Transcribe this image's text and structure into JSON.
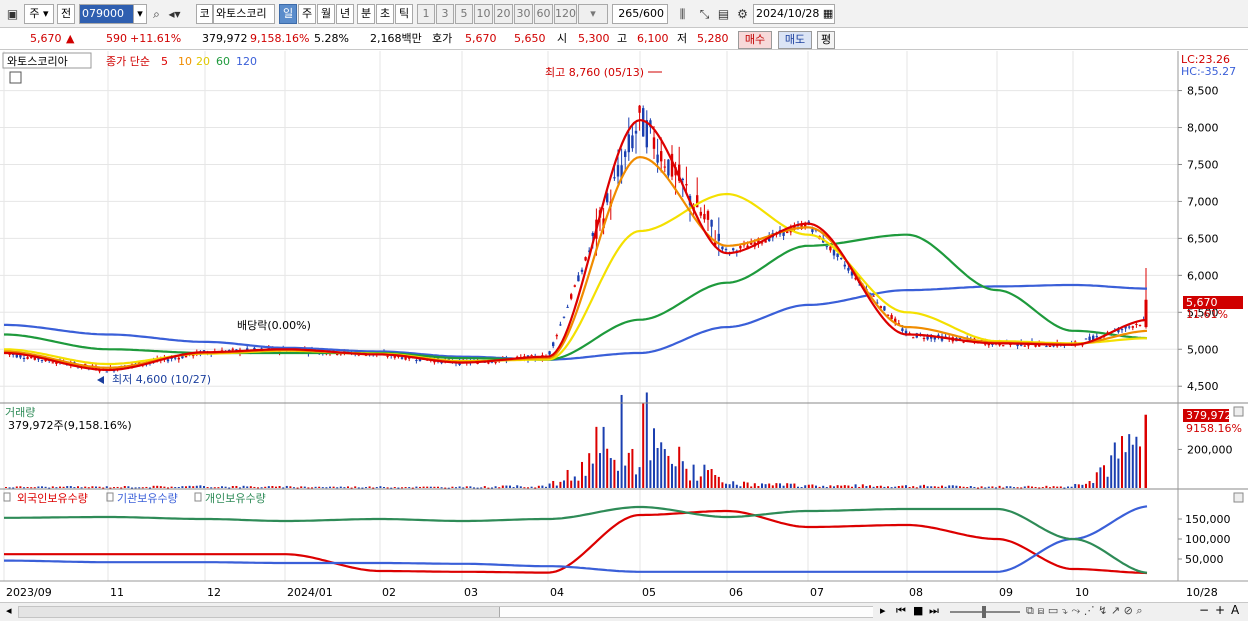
{
  "toolbar": {
    "mode": "주",
    "prev_label": "전",
    "stock_code": "079000",
    "market_tag": "코",
    "stock_name": "와토스코리",
    "periods": [
      "일",
      "주",
      "월",
      "년",
      "분",
      "초",
      "틱"
    ],
    "active_period": "일",
    "intervals": [
      "1",
      "3",
      "5",
      "10",
      "20",
      "30",
      "60",
      "120"
    ],
    "bar_count": "265",
    "bar_total": "/600",
    "date": "2024/10/28"
  },
  "quote": {
    "price": "5,670",
    "arrow": "▲",
    "change": "590",
    "change_pct": "+11.61%",
    "volume": "379,972",
    "volume_pct": "9,158.16%",
    "turnover": "5.28%",
    "amount": "2,168백만",
    "bid_label": "호가",
    "bid1": "5,670",
    "bid2": "5,650",
    "open_label": "시",
    "open": "5,300",
    "high_label": "고",
    "high": "6,100",
    "low_label": "저",
    "low": "5,280",
    "buy_button": "매수",
    "sell_button": "매도",
    "eval_button": "평"
  },
  "price_panel": {
    "name_tag": "와토스코리아",
    "legend_prefix": "종가 단순",
    "ma_periods": [
      "5",
      "10",
      "20",
      "60",
      "120"
    ],
    "ma_colors": [
      "#dc0000",
      "#f08c00",
      "#f4e000",
      "#1e9a3c",
      "#3a5fd8"
    ],
    "lc": "LC:23.26",
    "hc": "HC:-35.27",
    "high_annotation": "최고 8,760 (05/13)",
    "low_annotation": "최저 4,600 (10/27)",
    "dividend_annotation": "배당락(0.00%)",
    "last_price_tag": "5,670",
    "last_pct_tag": "11.61%"
  },
  "volume_panel": {
    "title": "거래량",
    "value_text": "379,972주(9,158.16%)",
    "tag_value": "379,972",
    "tag_pct": "9158.16%"
  },
  "holding_panel": {
    "legend": [
      "외국인보유수량",
      "기관보유수량",
      "개인보유수량"
    ],
    "legend_colors": [
      "#dc0000",
      "#3a5fd8",
      "#2e8b57"
    ]
  },
  "x_axis": {
    "labels": [
      "2023/09",
      "11",
      "12",
      "2024/01",
      "02",
      "03",
      "04",
      "05",
      "06",
      "07",
      "08",
      "09",
      "10"
    ],
    "right_label": "10/28"
  },
  "chart_data": [
    {
      "type": "line",
      "title": "와토스코리아",
      "ylabel": "",
      "yticks": [
        4500,
        5000,
        5500,
        6000,
        6500,
        7000,
        7500,
        8000,
        8500
      ],
      "ylim": [
        4300,
        8900
      ],
      "x": [
        "2023/09",
        "11",
        "12",
        "2024/01",
        "02",
        "03",
        "04",
        "05",
        "06",
        "07",
        "08",
        "09",
        "10",
        "10/28"
      ],
      "series": [
        {
          "name": "5",
          "values": [
            4950,
            4720,
            4960,
            5000,
            4930,
            4820,
            4900,
            8100,
            6300,
            6700,
            5200,
            5080,
            5060,
            5400
          ]
        },
        {
          "name": "10",
          "values": [
            4970,
            4750,
            4950,
            4990,
            4930,
            4830,
            4880,
            7600,
            6400,
            6650,
            5300,
            5090,
            5070,
            5250
          ]
        },
        {
          "name": "20",
          "values": [
            5000,
            4800,
            4940,
            4980,
            4940,
            4840,
            4860,
            6600,
            7100,
            6550,
            5500,
            5110,
            5080,
            5150
          ]
        },
        {
          "name": "60",
          "values": [
            5200,
            5000,
            4950,
            4950,
            4950,
            4880,
            4860,
            5400,
            5900,
            6400,
            6550,
            5800,
            5250,
            5150
          ]
        },
        {
          "name": "120",
          "values": [
            5330,
            5200,
            5100,
            5020,
            4970,
            4900,
            4860,
            4950,
            5300,
            5600,
            5800,
            5850,
            5870,
            5820
          ]
        }
      ]
    },
    {
      "type": "bar",
      "title": "거래량",
      "yticks": [
        200000
      ],
      "categories": [
        "2023/09",
        "11",
        "12",
        "2024/01",
        "02",
        "03",
        "04",
        "05",
        "06",
        "07",
        "08",
        "09",
        "10",
        "10/28"
      ],
      "values": [
        8000,
        9000,
        12000,
        9000,
        8000,
        7000,
        15000,
        330000,
        30000,
        18000,
        15000,
        10000,
        12000,
        379972
      ]
    },
    {
      "type": "line",
      "title": "",
      "yticks": [
        50000,
        100000,
        150000
      ],
      "x": [
        "2023/09",
        "11",
        "12",
        "2024/01",
        "02",
        "03",
        "04",
        "05",
        "06",
        "07",
        "08",
        "09",
        "10",
        "10/28"
      ],
      "series": [
        {
          "name": "외국인보유수량",
          "values": [
            62000,
            62000,
            62000,
            62000,
            20000,
            18000,
            16000,
            160000,
            170000,
            130000,
            135000,
            100000,
            25000,
            15000
          ]
        },
        {
          "name": "기관보유수량",
          "values": [
            46000,
            42000,
            42000,
            40000,
            40000,
            38000,
            32000,
            18000,
            18000,
            18000,
            18000,
            18000,
            100000,
            182000
          ]
        },
        {
          "name": "개인보유수량",
          "values": [
            153000,
            155000,
            150000,
            145000,
            150000,
            145000,
            150000,
            180000,
            155000,
            170000,
            175000,
            175000,
            100000,
            15000
          ]
        }
      ]
    }
  ]
}
